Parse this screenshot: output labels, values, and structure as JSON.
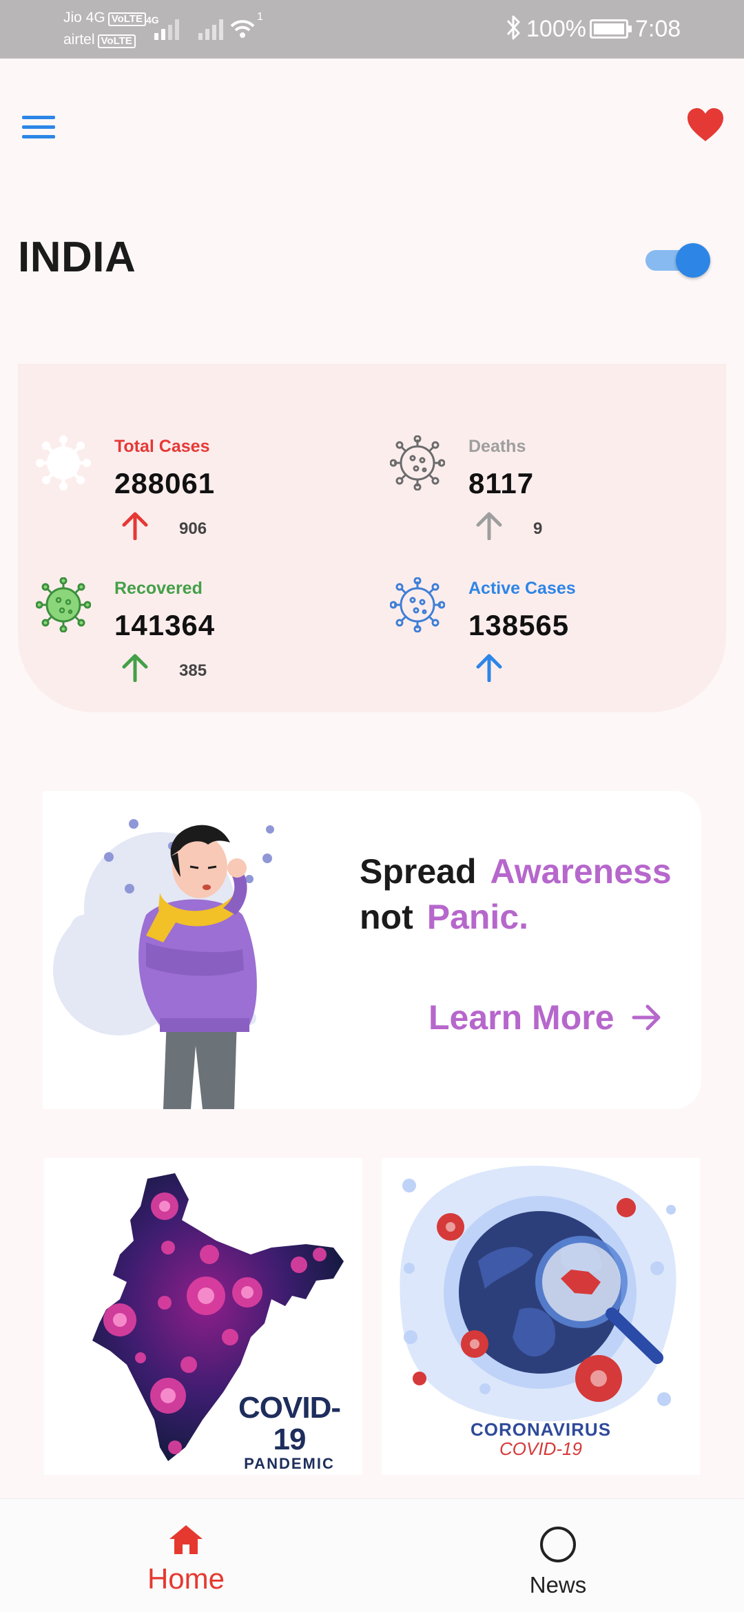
{
  "status_bar": {
    "carrier1": "Jio 4G",
    "carrier2": "airtel",
    "volte_badge": "VoLTE",
    "network_type": "4G",
    "wifi_badge": "1",
    "battery": "100%",
    "time": "7:08"
  },
  "header": {
    "menu_icon": "hamburger-menu-icon",
    "favorite_icon": "heart-icon"
  },
  "country": {
    "name": "INDIA",
    "toggle_on": true
  },
  "stats": {
    "total": {
      "label": "Total Cases",
      "value": "288061",
      "delta": "906",
      "color": "#E53935"
    },
    "deaths": {
      "label": "Deaths",
      "value": "8117",
      "delta": "9",
      "color": "#9E9E9E"
    },
    "recovered": {
      "label": "Recovered",
      "value": "141364",
      "delta": "385",
      "color": "#43A047"
    },
    "active": {
      "label": "Active Cases",
      "value": "138565",
      "delta": "",
      "color": "#2D86E6"
    }
  },
  "banner": {
    "word1": "Spread",
    "word2": "Awareness",
    "word3": "not",
    "word4": "Panic.",
    "cta": "Learn More"
  },
  "tiles": {
    "tile1": {
      "title": "COVID-19",
      "subtitle": "PANDEMIC"
    },
    "tile2": {
      "title": "CORONAVIRUS",
      "subtitle": "COVID-19"
    }
  },
  "bottom_nav": {
    "home": "Home",
    "news": "News"
  },
  "colors": {
    "accent_blue": "#2D86E6",
    "accent_red": "#E53935",
    "accent_purple": "#B667CC",
    "card_bg": "#FCEDED"
  }
}
